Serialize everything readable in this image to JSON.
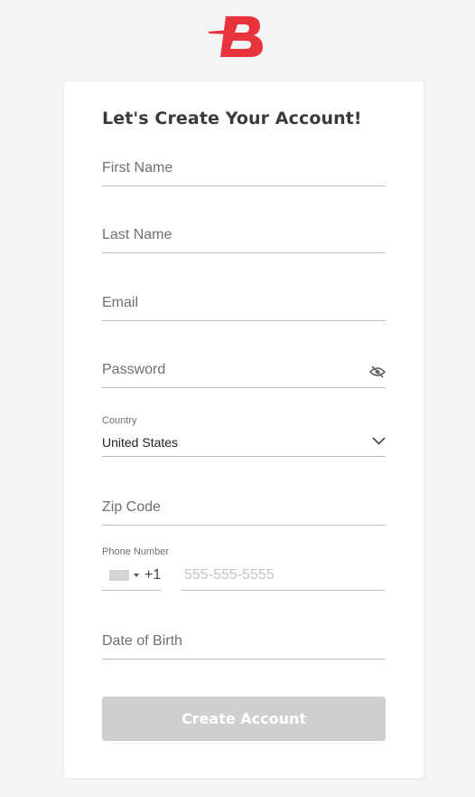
{
  "brand": {
    "logo_letter": "B",
    "accent_color": "#e8323c"
  },
  "form": {
    "title": "Let's Create Your Account!",
    "first_name": {
      "placeholder": "First Name"
    },
    "last_name": {
      "placeholder": "Last Name"
    },
    "email": {
      "placeholder": "Email"
    },
    "password": {
      "placeholder": "Password",
      "icon": "eye-off-icon"
    },
    "country": {
      "label": "Country",
      "value": "United States",
      "icon": "chevron-down-icon"
    },
    "zip": {
      "placeholder": "Zip Code"
    },
    "phone": {
      "label": "Phone Number",
      "dial_code": "+1",
      "placeholder": "555-555-5555",
      "flag_icon": "flag-icon"
    },
    "dob": {
      "placeholder": "Date of Birth"
    },
    "submit_label": "Create Account"
  }
}
